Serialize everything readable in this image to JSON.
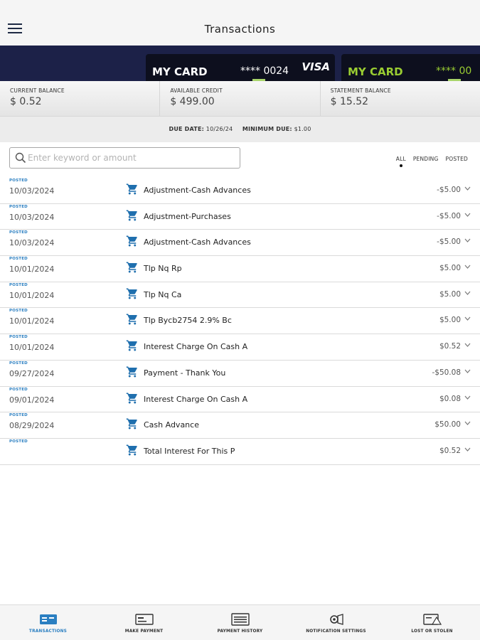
{
  "header": {
    "title": "Transactions"
  },
  "cards": [
    {
      "name": "MY CARD",
      "number": "**** 0024",
      "brand": "VISA"
    },
    {
      "name": "MY CARD",
      "number": "**** 00"
    }
  ],
  "balances": [
    {
      "label": "CURRENT BALANCE",
      "value": "$ 0.52"
    },
    {
      "label": "AVAILABLE CREDIT",
      "value": "$ 499.00"
    },
    {
      "label": "STATEMENT BALANCE",
      "value": "$ 15.52"
    }
  ],
  "due": {
    "due_label": "DUE DATE:",
    "due_value": "10/26/24",
    "min_label": "MINIMUM DUE:",
    "min_value": "$1.00"
  },
  "search": {
    "placeholder": "Enter keyword or amount"
  },
  "filters": {
    "all": "ALL",
    "pending": "PENDING",
    "posted": "POSTED"
  },
  "transactions": [
    {
      "status": "POSTED",
      "date": "10/03/2024",
      "description": "Adjustment-Cash Advances",
      "amount": "-$5.00"
    },
    {
      "status": "POSTED",
      "date": "10/03/2024",
      "description": "Adjustment-Purchases",
      "amount": "-$5.00"
    },
    {
      "status": "POSTED",
      "date": "10/03/2024",
      "description": "Adjustment-Cash Advances",
      "amount": "-$5.00"
    },
    {
      "status": "POSTED",
      "date": "10/01/2024",
      "description": "Tlp Nq Rp",
      "amount": "$5.00"
    },
    {
      "status": "POSTED",
      "date": "10/01/2024",
      "description": "Tlp Nq Ca",
      "amount": "$5.00"
    },
    {
      "status": "POSTED",
      "date": "10/01/2024",
      "description": "Tlp Bycb2754 2.9% Bc",
      "amount": "$5.00"
    },
    {
      "status": "POSTED",
      "date": "10/01/2024",
      "description": "Interest Charge On Cash A",
      "amount": "$0.52"
    },
    {
      "status": "POSTED",
      "date": "09/27/2024",
      "description": "Payment - Thank You",
      "amount": "-$50.08"
    },
    {
      "status": "POSTED",
      "date": "09/01/2024",
      "description": "Interest Charge On Cash A",
      "amount": "$0.08"
    },
    {
      "status": "POSTED",
      "date": "08/29/2024",
      "description": "Cash Advance",
      "amount": "$50.00"
    },
    {
      "status": "POSTED",
      "date": "",
      "description": "Total Interest For This P",
      "amount": "$0.52"
    }
  ],
  "nav": {
    "transactions": "TRANSACTIONS",
    "make_payment": "MAKE PAYMENT",
    "payment_history": "PAYMENT HISTORY",
    "notification_settings": "NOTIFICATION SETTINGS",
    "lost_or_stolen": "LOST OR STOLEN"
  },
  "colors": {
    "accent": "#2b7fc1",
    "card_bg": "#0d0f1e",
    "strip_bg": "#1c2148",
    "card2_text": "#9acd32"
  },
  "icons": [
    "menu-icon",
    "search-icon",
    "cart-icon",
    "chevron-down-icon",
    "transactions-icon",
    "make-payment-icon",
    "payment-history-icon",
    "notification-settings-icon",
    "lost-or-stolen-icon"
  ]
}
